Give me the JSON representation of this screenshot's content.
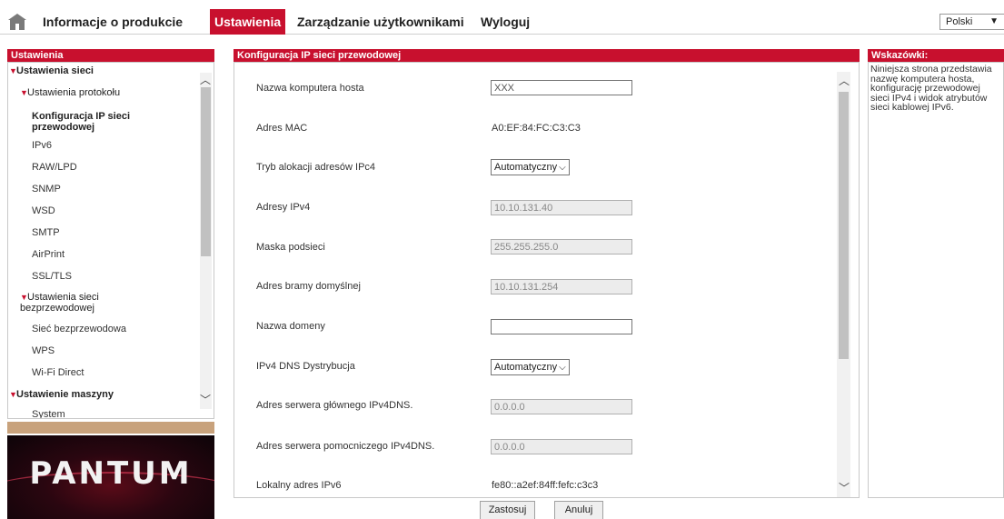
{
  "nav": {
    "home_icon": "home-icon",
    "items": [
      "Informacje o produkcie",
      "Ustawienia",
      "Zarządzanie użytkownikami",
      "Wyloguj"
    ],
    "active": "Ustawienia",
    "language": "Polski",
    "accent": "#c8102e"
  },
  "sidebar": {
    "title": "Ustawienia",
    "items": [
      {
        "label": "Ustawienia sieci",
        "type": "group"
      },
      {
        "label": "Ustawienia protokołu",
        "type": "subgroup"
      },
      {
        "label": "Konfiguracja IP sieci przewodowej",
        "type": "selected"
      },
      {
        "label": "IPv6",
        "type": "link"
      },
      {
        "label": "RAW/LPD",
        "type": "link"
      },
      {
        "label": "SNMP",
        "type": "link"
      },
      {
        "label": "WSD",
        "type": "link"
      },
      {
        "label": "SMTP",
        "type": "link"
      },
      {
        "label": "AirPrint",
        "type": "link"
      },
      {
        "label": "SSL/TLS",
        "type": "link"
      },
      {
        "label": "Ustawienia sieci bezprzewodowej",
        "type": "subgroup"
      },
      {
        "label": "Sieć bezprzewodowa",
        "type": "link"
      },
      {
        "label": "WPS",
        "type": "link"
      },
      {
        "label": "Wi-Fi Direct",
        "type": "link"
      },
      {
        "label": "Ustawienie maszyny",
        "type": "group"
      },
      {
        "label": "System",
        "type": "link"
      }
    ]
  },
  "main": {
    "title": "Konfiguracja IP sieci przewodowej",
    "fields": {
      "hostname": {
        "label": "Nazwa komputera hosta",
        "value": "XXX"
      },
      "mac": {
        "label": "Adres MAC",
        "value": "A0:EF:84:FC:C3:C3"
      },
      "alloc_mode": {
        "label": "Tryb alokacji adresów IPc4",
        "value": "Automatyczny"
      },
      "ipv4": {
        "label": "Adresy IPv4",
        "value": "10.10.131.40"
      },
      "mask": {
        "label": "Maska podsieci",
        "value": "255.255.255.0"
      },
      "gateway": {
        "label": "Adres bramy domyślnej",
        "value": "10.10.131.254"
      },
      "domain": {
        "label": "Nazwa domeny",
        "value": ""
      },
      "dns_dist": {
        "label": "IPv4 DNS Dystrybucja",
        "value": "Automatyczny"
      },
      "dns_primary": {
        "label": "Adres serwera głównego IPv4DNS.",
        "value": "0.0.0.0"
      },
      "dns_secondary": {
        "label": "Adres serwera pomocniczego IPv4DNS.",
        "value": "0.0.0.0"
      },
      "ipv6_local": {
        "label": "Lokalny adres IPv6",
        "value": "fe80::a2ef:84ff:fefc:c3c3"
      }
    },
    "buttons": {
      "apply": "Zastosuj",
      "cancel": "Anuluj"
    }
  },
  "tips": {
    "title": "Wskazówki:",
    "text": "Niniejsza strona przedstawia nazwę komputera hosta, konfigurację przewodowej sieci IPv4 i widok atrybutów sieci kablowej IPv6."
  },
  "logo": {
    "text": "PANTUM"
  }
}
